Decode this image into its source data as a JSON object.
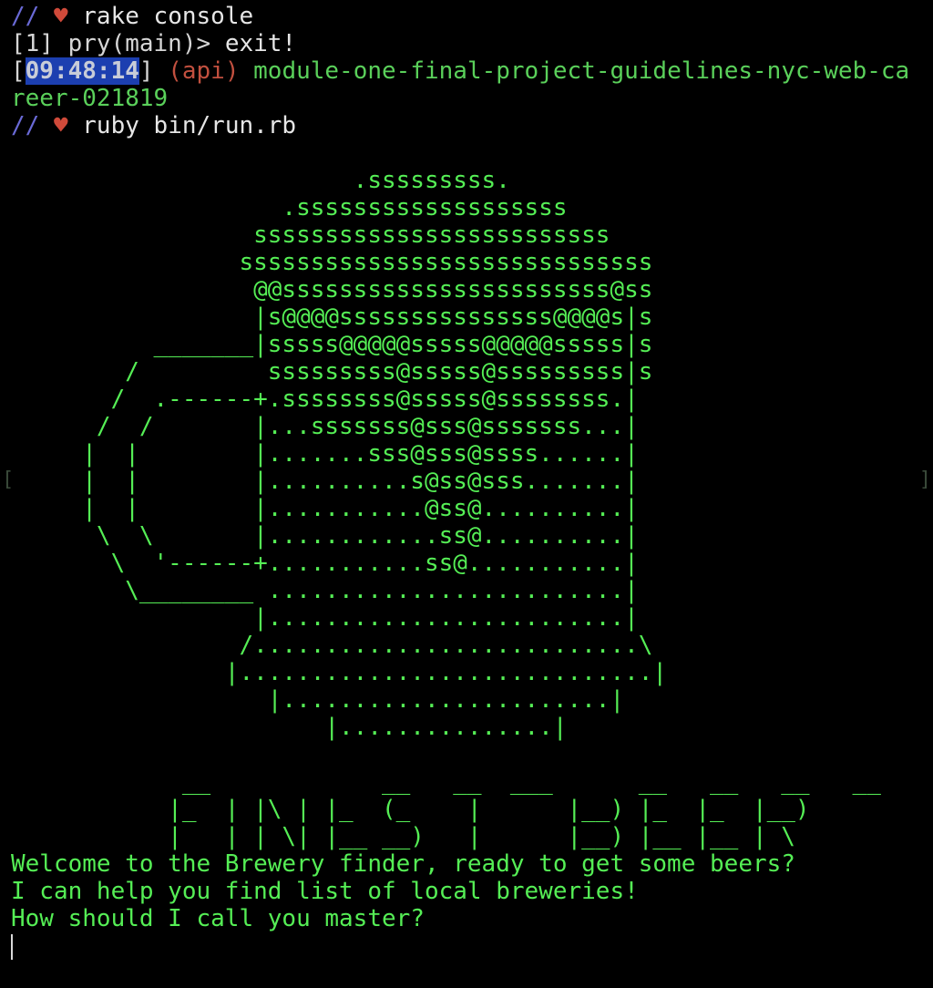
{
  "window": {
    "left_bracket": "[",
    "right_bracket": "]"
  },
  "history": {
    "line1": {
      "comment": "//",
      "heart": "♥",
      "command": "rake console"
    },
    "line2": {
      "prompt": "[1] pry(main)>",
      "command": "exit!"
    },
    "line3": {
      "open": "[",
      "time": "09:48:14",
      "close": "]",
      "env": "(api)",
      "dir_part1": "module-one-final-project-guidelines-nyc-web-ca",
      "dir_part2": "reer-021819"
    },
    "line5": {
      "comment": "//",
      "heart": "♥",
      "command": "ruby bin/run.rb"
    }
  },
  "ascii_art": {
    "beer_mug": [
      "                        .sssssssss.",
      "                   .sssssssssssssssssss",
      "                 sssssssssssssssssssssssss",
      "                sssssssssssssssssssssssssssss",
      "                 @@sssssssssssssssssssssss@ss",
      "                 |s@@@@sssssssssssssss@@@@s|s",
      "          _______|sssss@@@@@sssss@@@@@sssss|s",
      "        /         sssssssss@sssss@sssssssss|s",
      "       /  .------+.ssssssss@sssss@ssssssss.|",
      "      /  /       |...sssssss@sss@sssssss...|",
      "     |  |        |.......sss@sss@ssss......|",
      "     |  |        |..........s@ss@sss.......|",
      "     |  |        |...........@ss@..........|",
      "      \\  \\       |............ss@..........|",
      "       \\  '------+...........ss@...........|",
      "        \\________ .........................|",
      "                 |.........................|",
      "                /...........................\\",
      "               |.............................|",
      "                  |.......................|",
      "                      |...............|"
    ],
    "title": [
      "            __            __   __  ___      __   __   __   __",
      "           |_  | |\\ | |_  (_    |      |__) |_  |_  |__)",
      "           |   | | \\| |__ __)   |      |__) |__ |__ | \\"
    ]
  },
  "output": {
    "line1": "Welcome to the Brewery finder, ready to get some beers?",
    "line2": "I can help you find list of local breweries!",
    "line3": "How should I call you master?"
  }
}
